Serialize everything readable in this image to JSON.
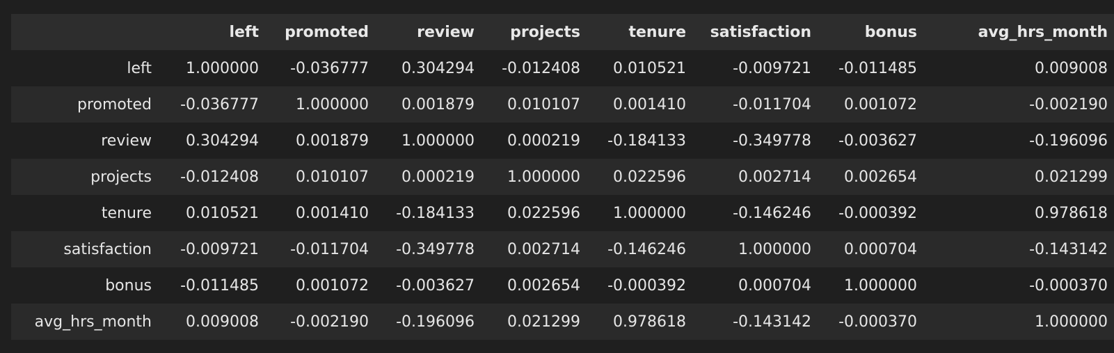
{
  "table": {
    "index_header": "",
    "columns": [
      "left",
      "promoted",
      "review",
      "projects",
      "tenure",
      "satisfaction",
      "bonus",
      "avg_hrs_month"
    ],
    "rows": [
      {
        "label": "left",
        "values": [
          "1.000000",
          "-0.036777",
          "0.304294",
          "-0.012408",
          "0.010521",
          "-0.009721",
          "-0.011485",
          "0.009008"
        ]
      },
      {
        "label": "promoted",
        "values": [
          "-0.036777",
          "1.000000",
          "0.001879",
          "0.010107",
          "0.001410",
          "-0.011704",
          "0.001072",
          "-0.002190"
        ]
      },
      {
        "label": "review",
        "values": [
          "0.304294",
          "0.001879",
          "1.000000",
          "0.000219",
          "-0.184133",
          "-0.349778",
          "-0.003627",
          "-0.196096"
        ]
      },
      {
        "label": "projects",
        "values": [
          "-0.012408",
          "0.010107",
          "0.000219",
          "1.000000",
          "0.022596",
          "0.002714",
          "0.002654",
          "0.021299"
        ]
      },
      {
        "label": "tenure",
        "values": [
          "0.010521",
          "0.001410",
          "-0.184133",
          "0.022596",
          "1.000000",
          "-0.146246",
          "-0.000392",
          "0.978618"
        ]
      },
      {
        "label": "satisfaction",
        "values": [
          "-0.009721",
          "-0.011704",
          "-0.349778",
          "0.002714",
          "-0.146246",
          "1.000000",
          "0.000704",
          "-0.143142"
        ]
      },
      {
        "label": "bonus",
        "values": [
          "-0.011485",
          "0.001072",
          "-0.003627",
          "0.002654",
          "-0.000392",
          "0.000704",
          "1.000000",
          "-0.000370"
        ]
      },
      {
        "label": "avg_hrs_month",
        "values": [
          "0.009008",
          "-0.002190",
          "-0.196096",
          "0.021299",
          "0.978618",
          "-0.143142",
          "-0.000370",
          "1.000000"
        ]
      }
    ]
  }
}
